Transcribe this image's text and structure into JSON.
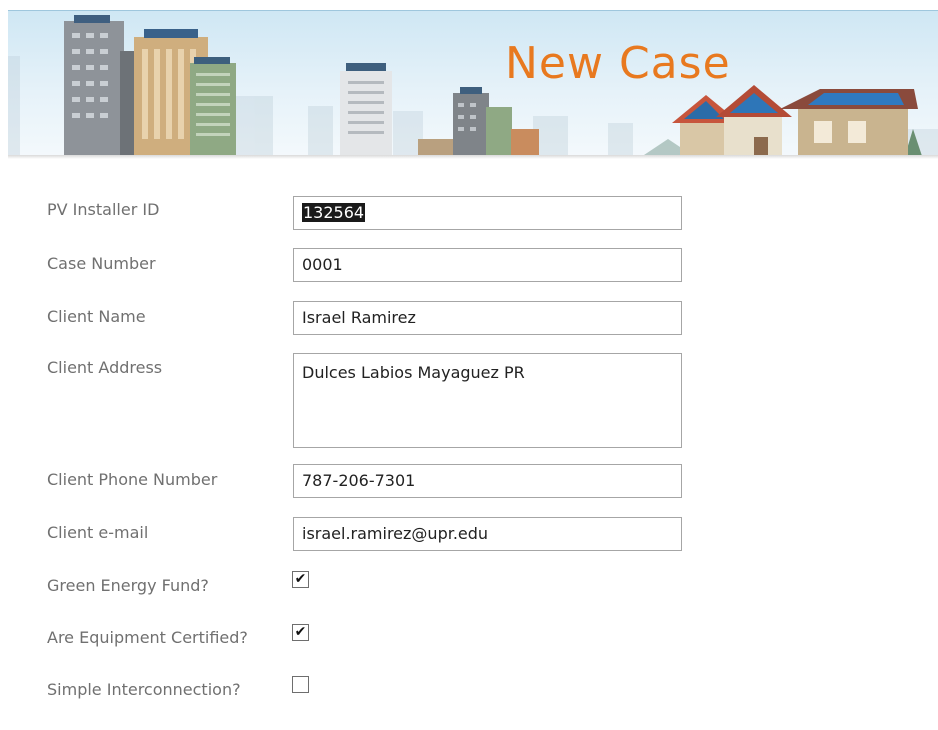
{
  "header": {
    "title": "New Case"
  },
  "form": {
    "pv_installer_id": {
      "label": "PV Installer ID",
      "value": "132564"
    },
    "case_number": {
      "label": "Case Number",
      "value": "0001"
    },
    "client_name": {
      "label": "Client Name",
      "value": "Israel Ramirez"
    },
    "client_address": {
      "label": "Client Address",
      "value": "Dulces Labios Mayaguez PR"
    },
    "client_phone": {
      "label": "Client Phone Number",
      "value": "787-206-7301"
    },
    "client_email": {
      "label": "Client e-mail",
      "value": "israel.ramirez@upr.edu"
    },
    "green_energy_fund": {
      "label": "Green Energy Fund?",
      "checked": true,
      "mark": "✔"
    },
    "equipment_certified": {
      "label": "Are Equipment Certified?",
      "checked": true,
      "mark": "✔"
    },
    "simple_interconnection": {
      "label": "Simple Interconnection?",
      "checked": false,
      "mark": ""
    }
  },
  "colors": {
    "title": "#e8791f",
    "label": "#707070",
    "field_border": "#a6a6a6",
    "selection": "#1a1a1a",
    "sky": "#cfe7f4"
  }
}
